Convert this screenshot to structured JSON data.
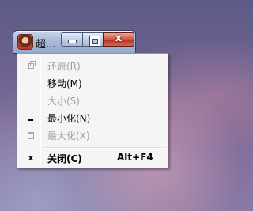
{
  "window": {
    "title": "超...",
    "icon": "app-avatar-icon",
    "buttons": {
      "minimize_icon": "minimize-icon",
      "maximize_icon": "maximize-icon",
      "close_glyph": "x"
    }
  },
  "menu": {
    "items": [
      {
        "label": "还原(R)",
        "enabled": false,
        "icon": "restore-icon"
      },
      {
        "label": "移动(M)",
        "enabled": true
      },
      {
        "label": "大小(S)",
        "enabled": false
      },
      {
        "label": "最小化(N)",
        "enabled": true,
        "icon": "minimize-icon"
      },
      {
        "label": "最大化(X)",
        "enabled": false,
        "icon": "maximize-icon"
      },
      {
        "label": "关闭(C)",
        "shortcut": "Alt+F4",
        "enabled": true,
        "bold": true,
        "icon": "close-icon",
        "glyph": "x"
      }
    ]
  },
  "colors": {
    "menu_bg": "#f5f5f5",
    "disabled_text": "#a0a0a0",
    "close_button": "#c7402e",
    "titlebar": "#a9bad9"
  }
}
